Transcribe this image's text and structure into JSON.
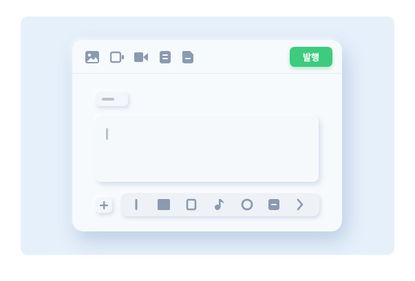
{
  "header": {
    "publish_label": "발행"
  },
  "top_icons": [
    "image-icon",
    "video-card-icon",
    "video-camera-icon",
    "document-icon",
    "note-icon"
  ],
  "format_tools": [
    "text-icon",
    "block-icon",
    "frame-icon",
    "music-note-icon",
    "circle-icon",
    "list-icon",
    "chevron-right-icon"
  ],
  "colors": {
    "accent": "#3ecb7e",
    "icon": "#8a9bb0",
    "background": "#e6f0fb",
    "card": "#f7fafd"
  }
}
